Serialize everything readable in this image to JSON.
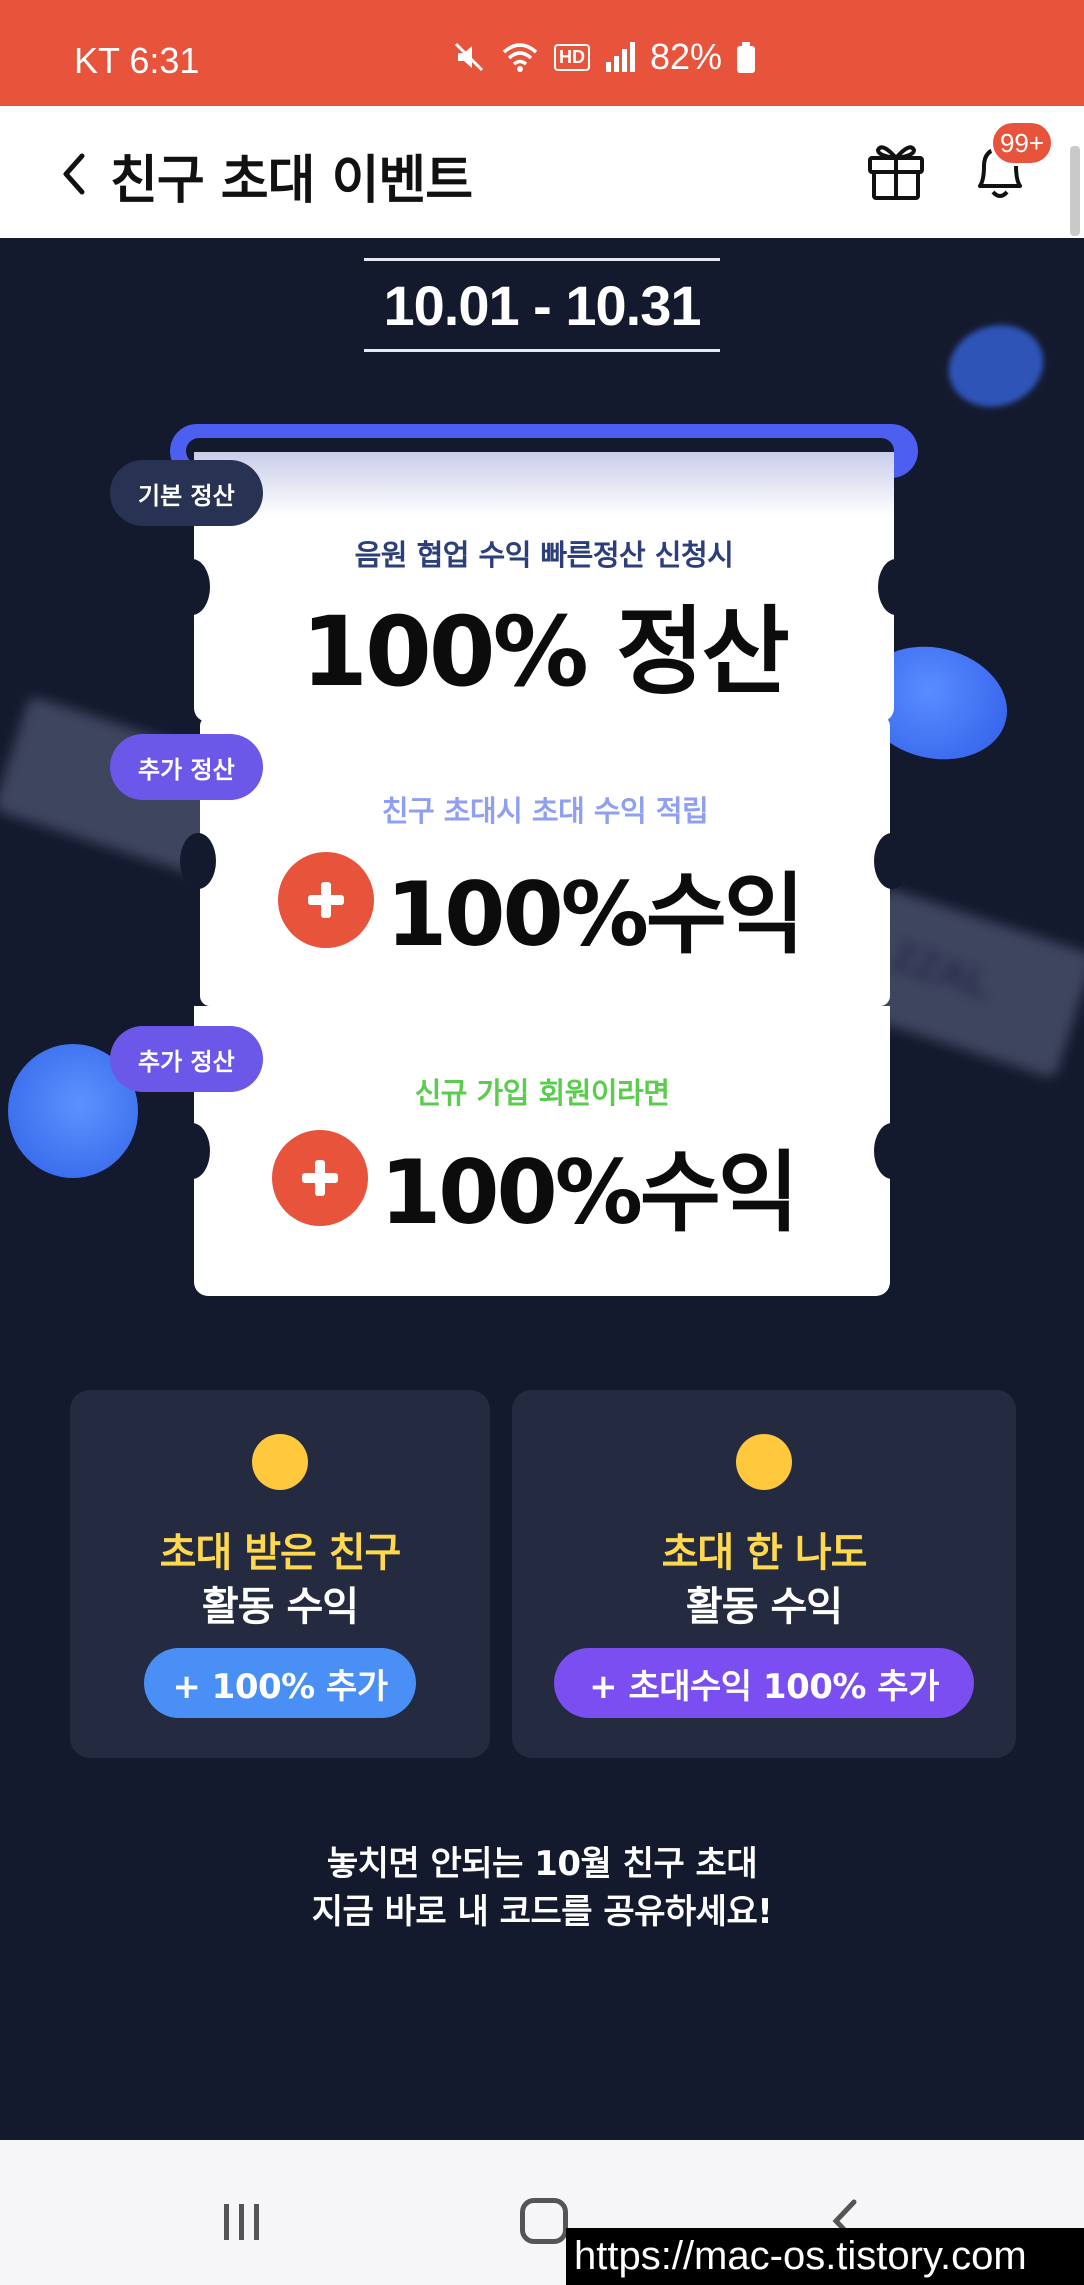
{
  "status_bar": {
    "carrier_time": "KT 6:31",
    "hd_label": "HD",
    "battery": "82%"
  },
  "header": {
    "title": "친구 초대 이벤트",
    "notification_badge": "99+"
  },
  "event": {
    "date_range": "10.01 - 10.31",
    "decor_ticket_text": "ZZAL",
    "tickets": [
      {
        "tag": "기본 정산",
        "subtitle": "음원 협업 수익 빠른정산 신청시",
        "main": "100% 정산",
        "subtitle_color": "#2d3f7a"
      },
      {
        "tag": "추가 정산",
        "subtitle": "친구 초대시 초대 수익 적립",
        "main": "100%수익",
        "subtitle_color": "#8f9ff2"
      },
      {
        "tag": "추가 정산",
        "subtitle": "신규 가입 회원이라면",
        "main": "100%수익",
        "subtitle_color": "#5ccc4f"
      }
    ]
  },
  "cards": [
    {
      "emoji": "party-face-emoji",
      "line1": "초대 받은 친구",
      "line2": "활동 수익",
      "pill": "+ 100% 추가"
    },
    {
      "emoji": "sunglasses-face-emoji",
      "line1": "초대 한 나도",
      "line2": "활동 수익",
      "pill": "+ 초대수익 100% 추가"
    }
  ],
  "bottom_message": {
    "line1": "놓치면 안되는 10월 친구 초대",
    "line2": "지금 바로 내 코드를 공유하세요!"
  },
  "watermark": "https://mac-os.tistory.com",
  "colors": {
    "status_bar": "#e8533b",
    "background": "#141a2e",
    "accent_blue": "#4c5ff0",
    "plus_red": "#e8533b",
    "highlight_yellow": "#ffd84d"
  }
}
